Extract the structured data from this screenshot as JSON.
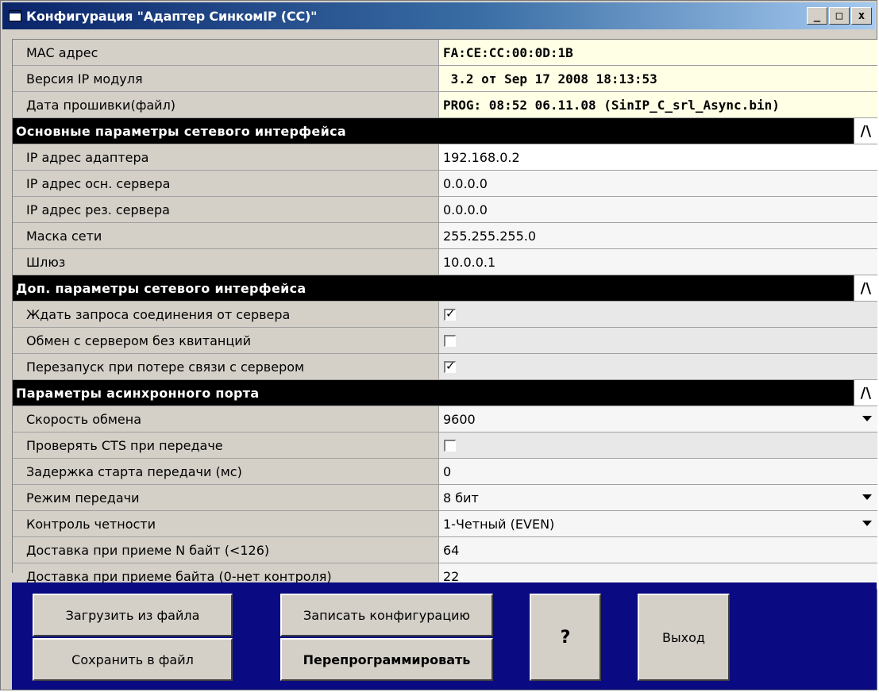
{
  "window": {
    "title": "Конфигурация \"Адаптер СинкомIP (СС)\"",
    "controls": {
      "minimize": "_",
      "maximize": "□",
      "close": "x"
    }
  },
  "info_rows": [
    {
      "label": "MAC адрес",
      "value": "FA:CE:CC:00:0D:1B"
    },
    {
      "label": "Версия IP модуля",
      "value": " 3.2 от Sep 17 2008 18:13:53"
    },
    {
      "label": "Дата прошивки(файл)",
      "value": "PROG: 08:52 06.11.08 (SinIP_C_srl_Async.bin)"
    }
  ],
  "sections": [
    {
      "title": "Основные параметры сетевого интерфейса",
      "toggle": "/\\",
      "rows": [
        {
          "label": "IP адрес адаптера",
          "value": "192.168.0.2"
        },
        {
          "label": "IP адрес осн. сервера",
          "value": "0.0.0.0"
        },
        {
          "label": "IP адрес рез. сервера",
          "value": "0.0.0.0"
        },
        {
          "label": "Маска сети",
          "value": "255.255.255.0"
        },
        {
          "label": "Шлюз",
          "value": "10.0.0.1"
        }
      ]
    },
    {
      "title": "Доп. параметры сетевого интерфейса",
      "toggle": "/\\",
      "rows": [
        {
          "label": "Ждать запроса соединения от сервера",
          "checked": true
        },
        {
          "label": "Обмен с сервером без квитанций",
          "checked": false
        },
        {
          "label": "Перезапуск при потере связи с сервером",
          "checked": true
        }
      ]
    },
    {
      "title": "Параметры асинхронного порта",
      "toggle": "/\\",
      "rows": [
        {
          "label": "Скорость обмена",
          "value": "9600",
          "dropdown": true
        },
        {
          "label": "Проверять CTS при передаче",
          "checked": false
        },
        {
          "label": "Задержка старта передачи (мс)",
          "value": "0"
        },
        {
          "label": "Режим передачи",
          "value": "8 бит",
          "dropdown": true
        },
        {
          "label": "Контроль четности",
          "value": "1-Четный (EVEN)",
          "dropdown": true
        },
        {
          "label": "Доставка при приеме N байт (<126)",
          "value": "64"
        },
        {
          "label": "Доставка при приеме байта (0-нет контроля)",
          "value": "22"
        }
      ]
    }
  ],
  "buttons": {
    "load_file": "Загрузить из файла",
    "save_file": "Сохранить в файл",
    "write_config": "Записать конфигурацию",
    "reprogram": "Перепрограммировать",
    "help": "?",
    "exit": "Выход"
  },
  "colors": {
    "title_gradient_start": "#0a246a",
    "section_header_bg": "#000000",
    "button_panel_bg": "#0a0a82",
    "info_value_bg": "#ffffe6"
  }
}
